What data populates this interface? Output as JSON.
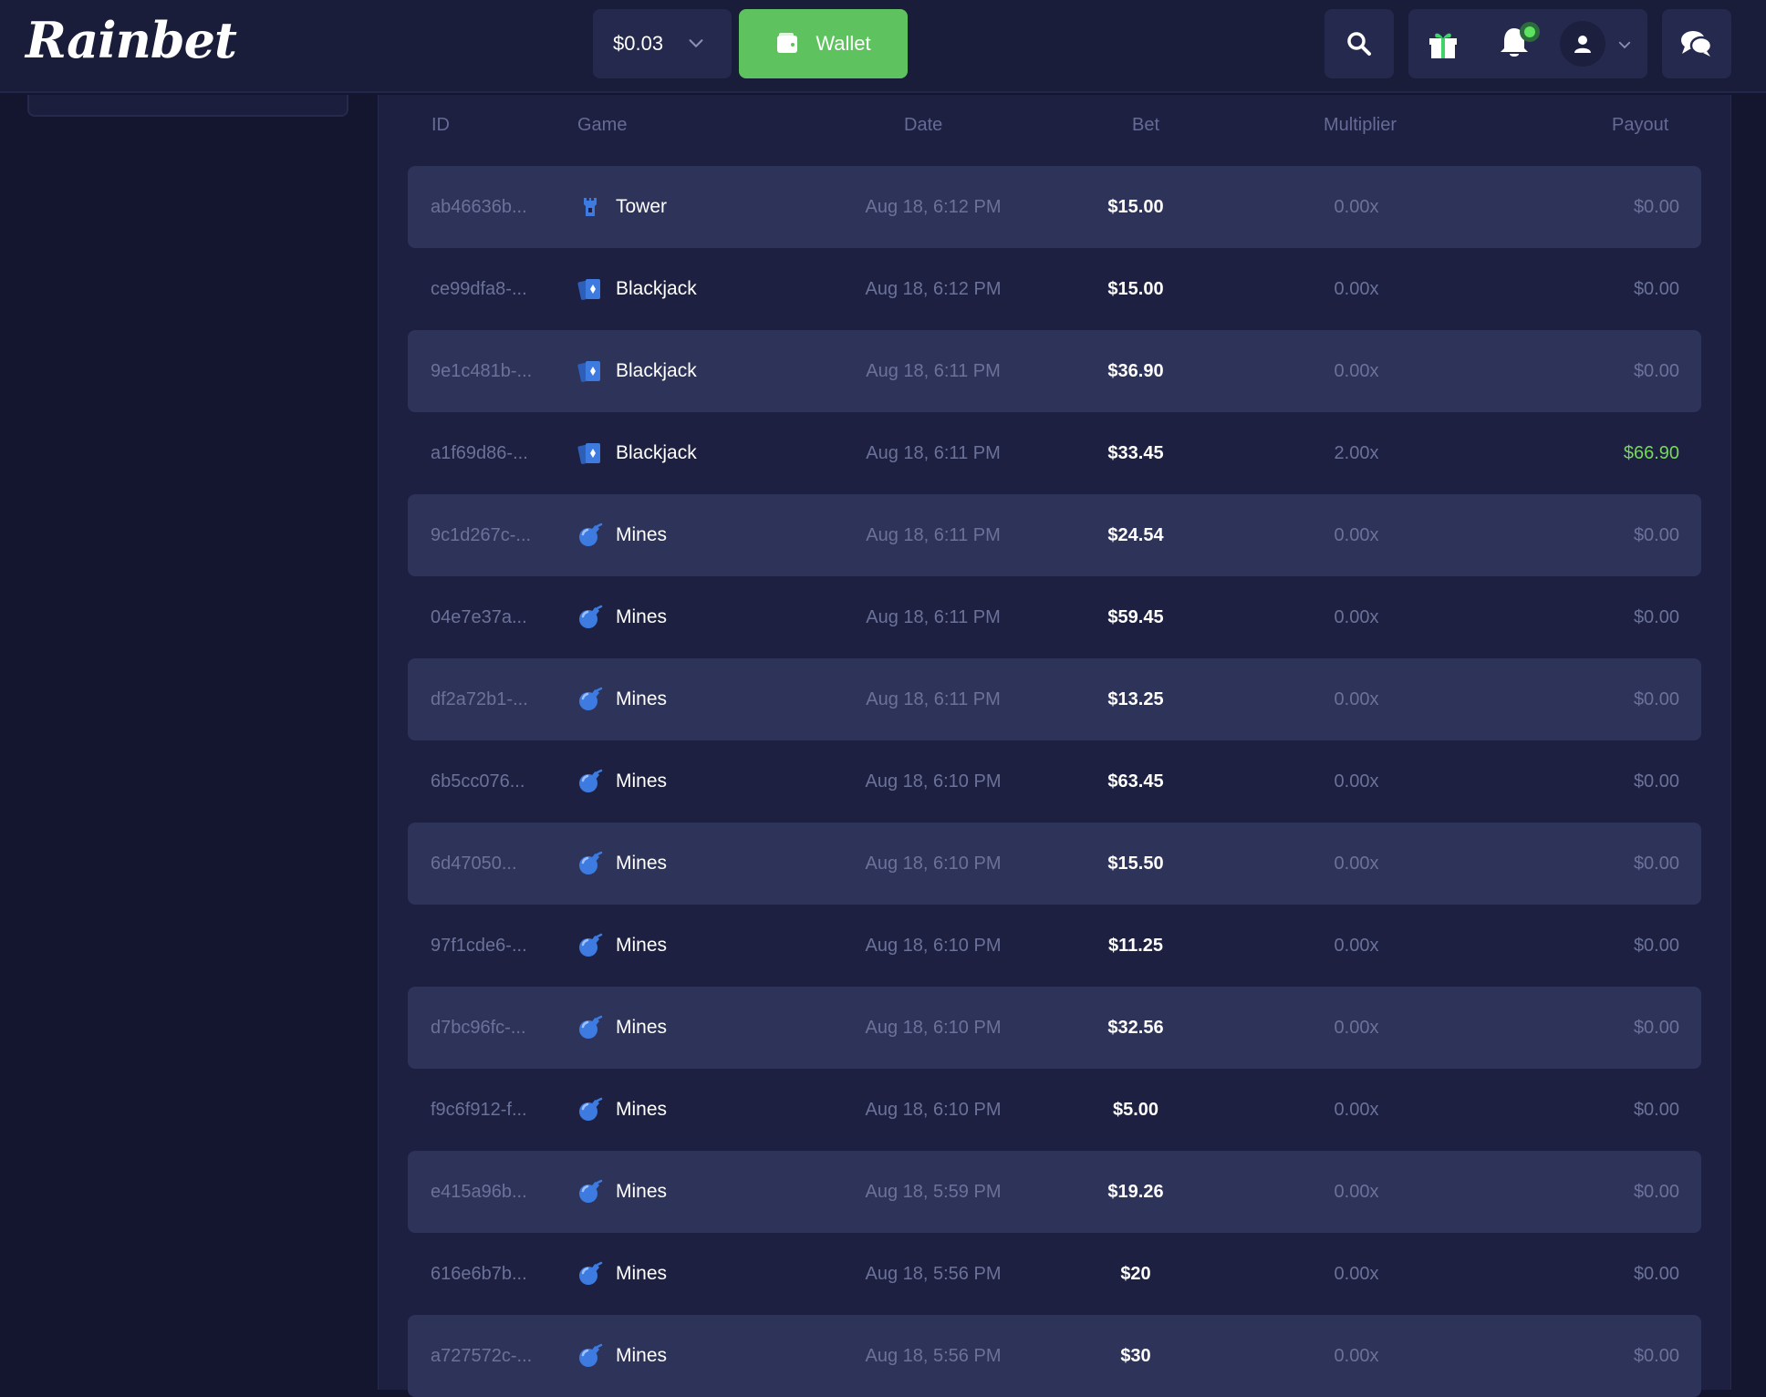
{
  "header": {
    "logo": "Rainbet",
    "balance": "$0.03",
    "wallet_label": "Wallet",
    "icons": [
      "search-icon",
      "gift-icon",
      "bell-icon",
      "user-icon",
      "chat-icon"
    ]
  },
  "table": {
    "columns": [
      "ID",
      "Game",
      "Date",
      "Bet",
      "Multiplier",
      "Payout"
    ],
    "rows": [
      {
        "id": "ab46636b...",
        "game": "Tower",
        "icon": "tower-icon",
        "date": "Aug 18, 6:12 PM",
        "bet": "$15.00",
        "multiplier": "0.00x",
        "payout": "$0.00"
      },
      {
        "id": "ce99dfa8-...",
        "game": "Blackjack",
        "icon": "blackjack-icon",
        "date": "Aug 18, 6:12 PM",
        "bet": "$15.00",
        "multiplier": "0.00x",
        "payout": "$0.00"
      },
      {
        "id": "9e1c481b-...",
        "game": "Blackjack",
        "icon": "blackjack-icon",
        "date": "Aug 18, 6:11 PM",
        "bet": "$36.90",
        "multiplier": "0.00x",
        "payout": "$0.00"
      },
      {
        "id": "a1f69d86-...",
        "game": "Blackjack",
        "icon": "blackjack-icon",
        "date": "Aug 18, 6:11 PM",
        "bet": "$33.45",
        "multiplier": "2.00x",
        "payout": "$66.90"
      },
      {
        "id": "9c1d267c-...",
        "game": "Mines",
        "icon": "mines-icon",
        "date": "Aug 18, 6:11 PM",
        "bet": "$24.54",
        "multiplier": "0.00x",
        "payout": "$0.00"
      },
      {
        "id": "04e7e37a...",
        "game": "Mines",
        "icon": "mines-icon",
        "date": "Aug 18, 6:11 PM",
        "bet": "$59.45",
        "multiplier": "0.00x",
        "payout": "$0.00"
      },
      {
        "id": "df2a72b1-...",
        "game": "Mines",
        "icon": "mines-icon",
        "date": "Aug 18, 6:11 PM",
        "bet": "$13.25",
        "multiplier": "0.00x",
        "payout": "$0.00"
      },
      {
        "id": "6b5cc076...",
        "game": "Mines",
        "icon": "mines-icon",
        "date": "Aug 18, 6:10 PM",
        "bet": "$63.45",
        "multiplier": "0.00x",
        "payout": "$0.00"
      },
      {
        "id": "6d47050...",
        "game": "Mines",
        "icon": "mines-icon",
        "date": "Aug 18, 6:10 PM",
        "bet": "$15.50",
        "multiplier": "0.00x",
        "payout": "$0.00"
      },
      {
        "id": "97f1cde6-...",
        "game": "Mines",
        "icon": "mines-icon",
        "date": "Aug 18, 6:10 PM",
        "bet": "$11.25",
        "multiplier": "0.00x",
        "payout": "$0.00"
      },
      {
        "id": "d7bc96fc-...",
        "game": "Mines",
        "icon": "mines-icon",
        "date": "Aug 18, 6:10 PM",
        "bet": "$32.56",
        "multiplier": "0.00x",
        "payout": "$0.00"
      },
      {
        "id": "f9c6f912-f...",
        "game": "Mines",
        "icon": "mines-icon",
        "date": "Aug 18, 6:10 PM",
        "bet": "$5.00",
        "multiplier": "0.00x",
        "payout": "$0.00"
      },
      {
        "id": "e415a96b...",
        "game": "Mines",
        "icon": "mines-icon",
        "date": "Aug 18, 5:59 PM",
        "bet": "$19.26",
        "multiplier": "0.00x",
        "payout": "$0.00"
      },
      {
        "id": "616e6b7b...",
        "game": "Mines",
        "icon": "mines-icon",
        "date": "Aug 18, 5:56 PM",
        "bet": "$20",
        "multiplier": "0.00x",
        "payout": "$0.00"
      },
      {
        "id": "a727572c-...",
        "game": "Mines",
        "icon": "mines-icon",
        "date": "Aug 18, 5:56 PM",
        "bet": "$30",
        "multiplier": "0.00x",
        "payout": "$0.00"
      }
    ]
  },
  "colors": {
    "background": "#141630",
    "topbar": "#1a1d3a",
    "panel": "#1d2040",
    "row_shaded": "#2e3359",
    "wallet_green": "#5ec35f",
    "win_green": "#76d95a",
    "muted_text": "#6b7299",
    "game_icon_blue": "#3d7be0"
  }
}
